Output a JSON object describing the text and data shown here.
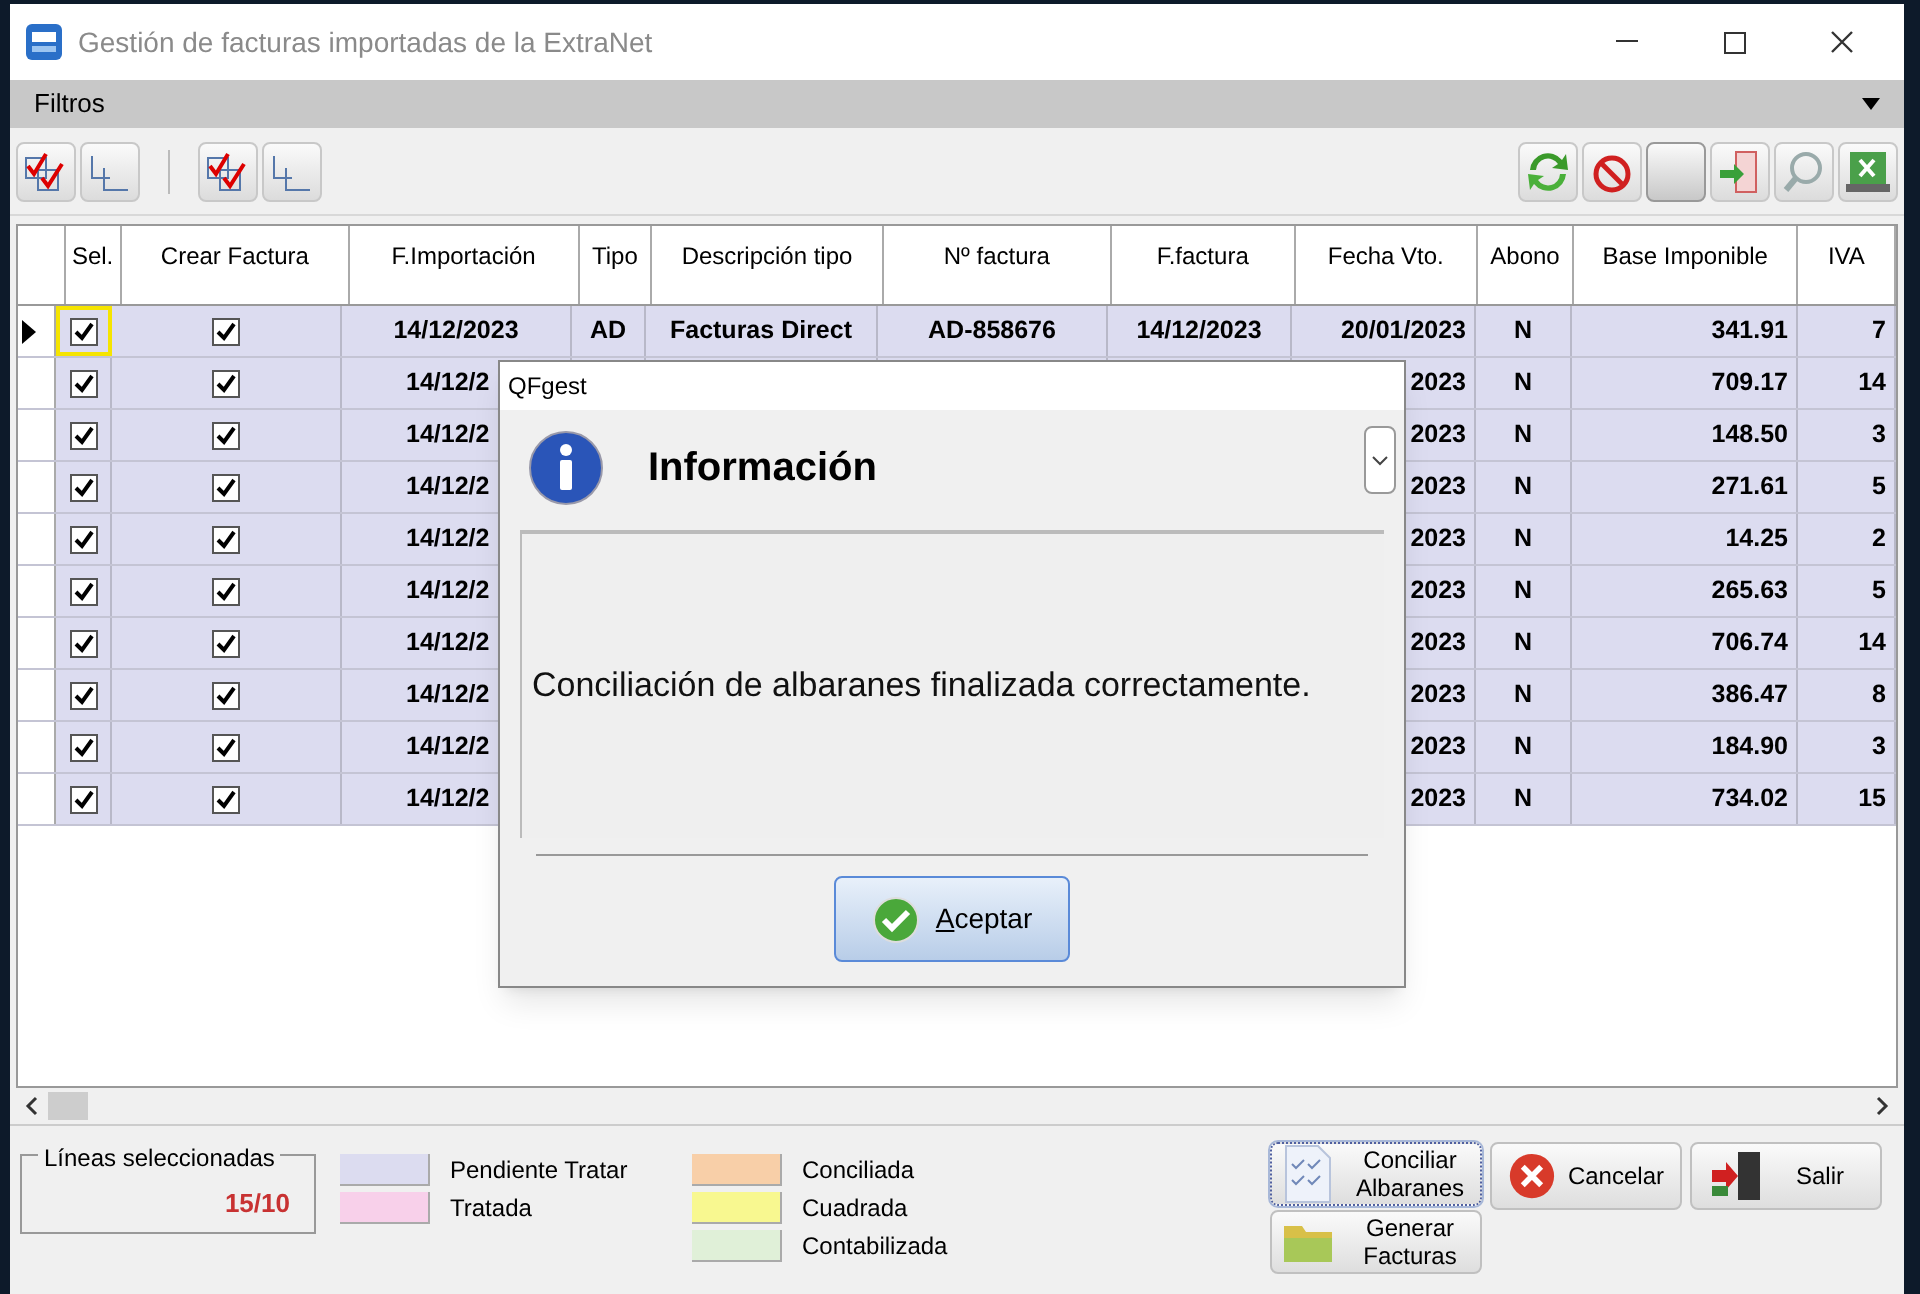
{
  "window": {
    "title": "Gestión de facturas importadas de la ExtraNet"
  },
  "menu": {
    "label": "Filtros"
  },
  "table": {
    "columns": [
      "Sel.",
      "Crear Factura",
      "F.Importación",
      "Tipo",
      "Descripción tipo",
      "Nº factura",
      "F.factura",
      "Fecha Vto.",
      "Abono",
      "Base Imponible",
      "IVA"
    ],
    "rows": [
      {
        "current": true,
        "sel": true,
        "crear": true,
        "importacion": "14/12/2023",
        "tipo": "AD",
        "descripcion": "Facturas Direct",
        "factura": "AD-858676",
        "ffactura": "14/12/2023",
        "vto": "20/01/2023",
        "abono": "N",
        "base": "341.91",
        "iva": "7"
      },
      {
        "current": false,
        "sel": true,
        "crear": true,
        "importacion": "14/12/2",
        "vto": "2023",
        "abono": "N",
        "base": "709.17",
        "iva": "14"
      },
      {
        "current": false,
        "sel": true,
        "crear": true,
        "importacion": "14/12/2",
        "vto": "2023",
        "abono": "N",
        "base": "148.50",
        "iva": "3"
      },
      {
        "current": false,
        "sel": true,
        "crear": true,
        "importacion": "14/12/2",
        "vto": "2023",
        "abono": "N",
        "base": "271.61",
        "iva": "5"
      },
      {
        "current": false,
        "sel": true,
        "crear": true,
        "importacion": "14/12/2",
        "vto": "2023",
        "abono": "N",
        "base": "14.25",
        "iva": "2"
      },
      {
        "current": false,
        "sel": true,
        "crear": true,
        "importacion": "14/12/2",
        "vto": "2023",
        "abono": "N",
        "base": "265.63",
        "iva": "5"
      },
      {
        "current": false,
        "sel": true,
        "crear": true,
        "importacion": "14/12/2",
        "vto": "2023",
        "abono": "N",
        "base": "706.74",
        "iva": "14"
      },
      {
        "current": false,
        "sel": true,
        "crear": true,
        "importacion": "14/12/2",
        "vto": "2023",
        "abono": "N",
        "base": "386.47",
        "iva": "8"
      },
      {
        "current": false,
        "sel": true,
        "crear": true,
        "importacion": "14/12/2",
        "vto": "2023",
        "abono": "N",
        "base": "184.90",
        "iva": "3"
      },
      {
        "current": false,
        "sel": true,
        "crear": true,
        "importacion": "14/12/2",
        "vto": "2023",
        "abono": "N",
        "base": "734.02",
        "iva": "15"
      }
    ]
  },
  "counter": {
    "label": "Líneas seleccionadas",
    "value": "15/10"
  },
  "legend": [
    {
      "label": "Pendiente Tratar",
      "color": "#dcdcf0"
    },
    {
      "label": "Tratada",
      "color": "#f8d0ea"
    },
    {
      "label": "Conciliada",
      "color": "#f8cfa8"
    },
    {
      "label": "Cuadrada",
      "color": "#f8f890"
    },
    {
      "label": "Contabilizada",
      "color": "#e0f0d8"
    }
  ],
  "buttons": [
    {
      "kind": "conciliar",
      "label": "Conciliar Albaranes",
      "focused": true
    },
    {
      "kind": "generar",
      "label": "Generar Facturas",
      "focused": false
    },
    {
      "kind": "cancelar",
      "label": "Cancelar",
      "focused": false
    },
    {
      "kind": "salir",
      "label": "Salir",
      "focused": false
    }
  ],
  "dialog": {
    "title": "QFgest",
    "heading": "Información",
    "message": "Conciliación de albaranes finalizada correctamente.",
    "button": "Aceptar"
  }
}
